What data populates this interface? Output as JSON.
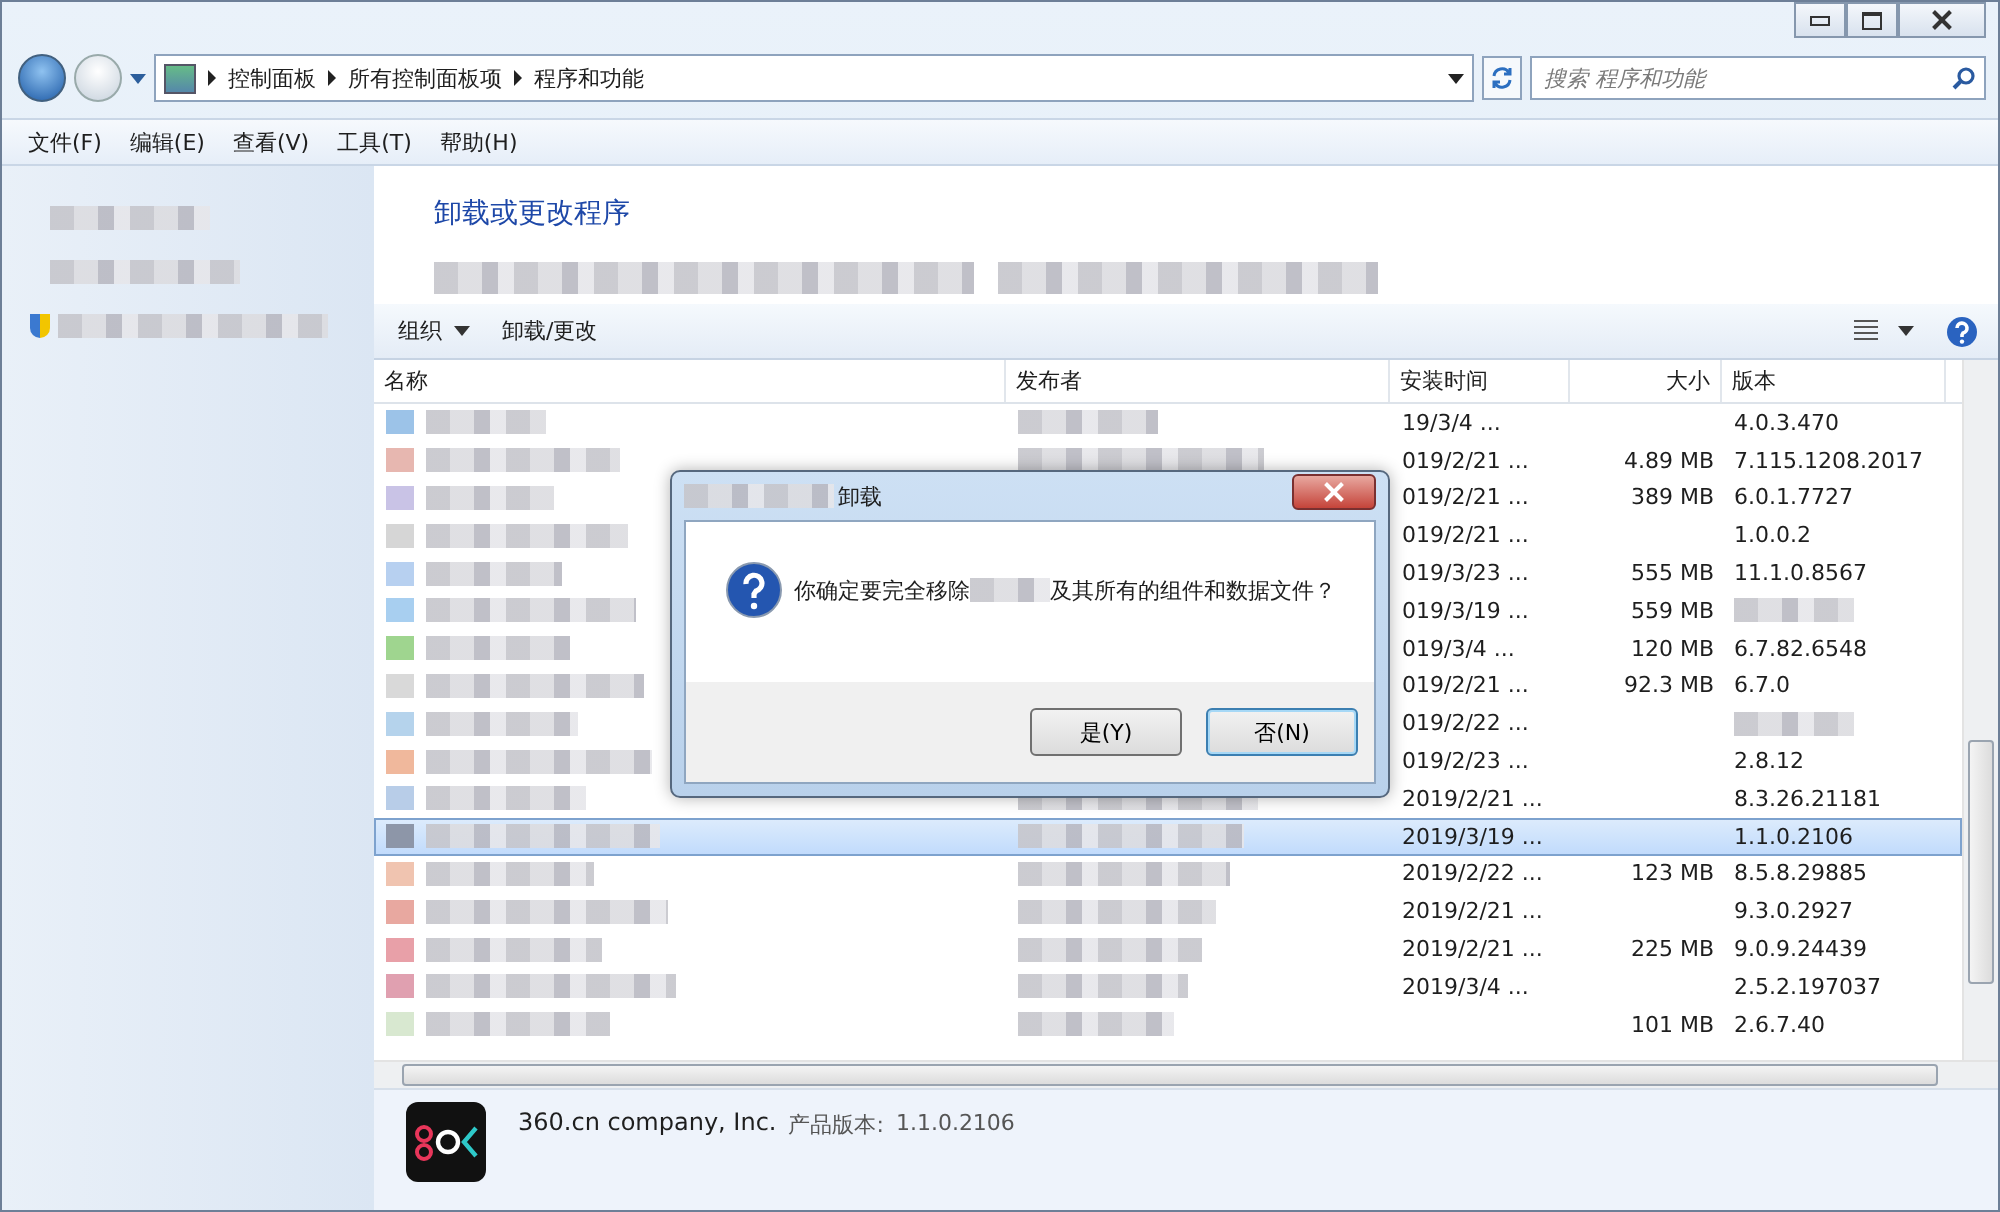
{
  "address_bar": {
    "crumbs": [
      "控制面板",
      "所有控制面板项",
      "程序和功能"
    ]
  },
  "search": {
    "placeholder": "搜索 程序和功能"
  },
  "menu": [
    "文件(F)",
    "编辑(E)",
    "查看(V)",
    "工具(T)",
    "帮助(H)"
  ],
  "content": {
    "title": "卸载或更改程序"
  },
  "toolbar": {
    "organize": "组织",
    "uninstall": "卸载/更改"
  },
  "table": {
    "columns": [
      "名称",
      "发布者",
      "安装时间",
      "大小",
      "版本"
    ],
    "rows": [
      {
        "date": "19/3/4 ...",
        "size": "",
        "version": "4.0.3.470",
        "selected": false
      },
      {
        "date": "019/2/21 ...",
        "size": "4.89 MB",
        "version": "7.115.1208.2017",
        "selected": false
      },
      {
        "date": "019/2/21 ...",
        "size": "389 MB",
        "version": "6.0.1.7727",
        "selected": false
      },
      {
        "date": "019/2/21 ...",
        "size": "",
        "version": "1.0.0.2",
        "selected": false
      },
      {
        "date": "019/3/23 ...",
        "size": "555 MB",
        "version": "11.1.0.8567",
        "selected": false
      },
      {
        "date": "019/3/19 ...",
        "size": "559 MB",
        "version": "",
        "selected": false
      },
      {
        "date": "019/3/4 ...",
        "size": "120 MB",
        "version": "6.7.82.6548",
        "selected": false
      },
      {
        "date": "019/2/21 ...",
        "size": "92.3 MB",
        "version": "6.7.0",
        "selected": false
      },
      {
        "date": "019/2/22 ...",
        "size": "",
        "version": "",
        "selected": false
      },
      {
        "date": "019/2/23 ...",
        "size": "",
        "version": "2.8.12",
        "selected": false
      },
      {
        "date": "2019/2/21 ...",
        "size": "",
        "version": "8.3.26.21181",
        "selected": false
      },
      {
        "date": "2019/3/19 ...",
        "size": "",
        "version": "1.1.0.2106",
        "selected": true
      },
      {
        "date": "2019/2/22 ...",
        "size": "123 MB",
        "version": "8.5.8.29885",
        "selected": false
      },
      {
        "date": "2019/2/21 ...",
        "size": "",
        "version": "9.3.0.2927",
        "selected": false
      },
      {
        "date": "2019/2/21 ...",
        "size": "225 MB",
        "version": "9.0.9.24439",
        "selected": false
      },
      {
        "date": "2019/3/4 ...",
        "size": "",
        "version": "2.5.2.197037",
        "selected": false
      },
      {
        "date": "",
        "size": "101 MB",
        "version": "2.6.7.40",
        "selected": false
      }
    ]
  },
  "details": {
    "publisher": "360.cn company, Inc.",
    "version_label": "产品版本:",
    "version": "1.1.0.2106"
  },
  "dialog": {
    "title": "卸载",
    "message_before": "你确定要完全移除",
    "message_after": "及其所有的组件和数据文件？",
    "buttons": [
      {
        "label": "是(Y)",
        "default": false
      },
      {
        "label": "否(N)",
        "default": true
      }
    ]
  }
}
